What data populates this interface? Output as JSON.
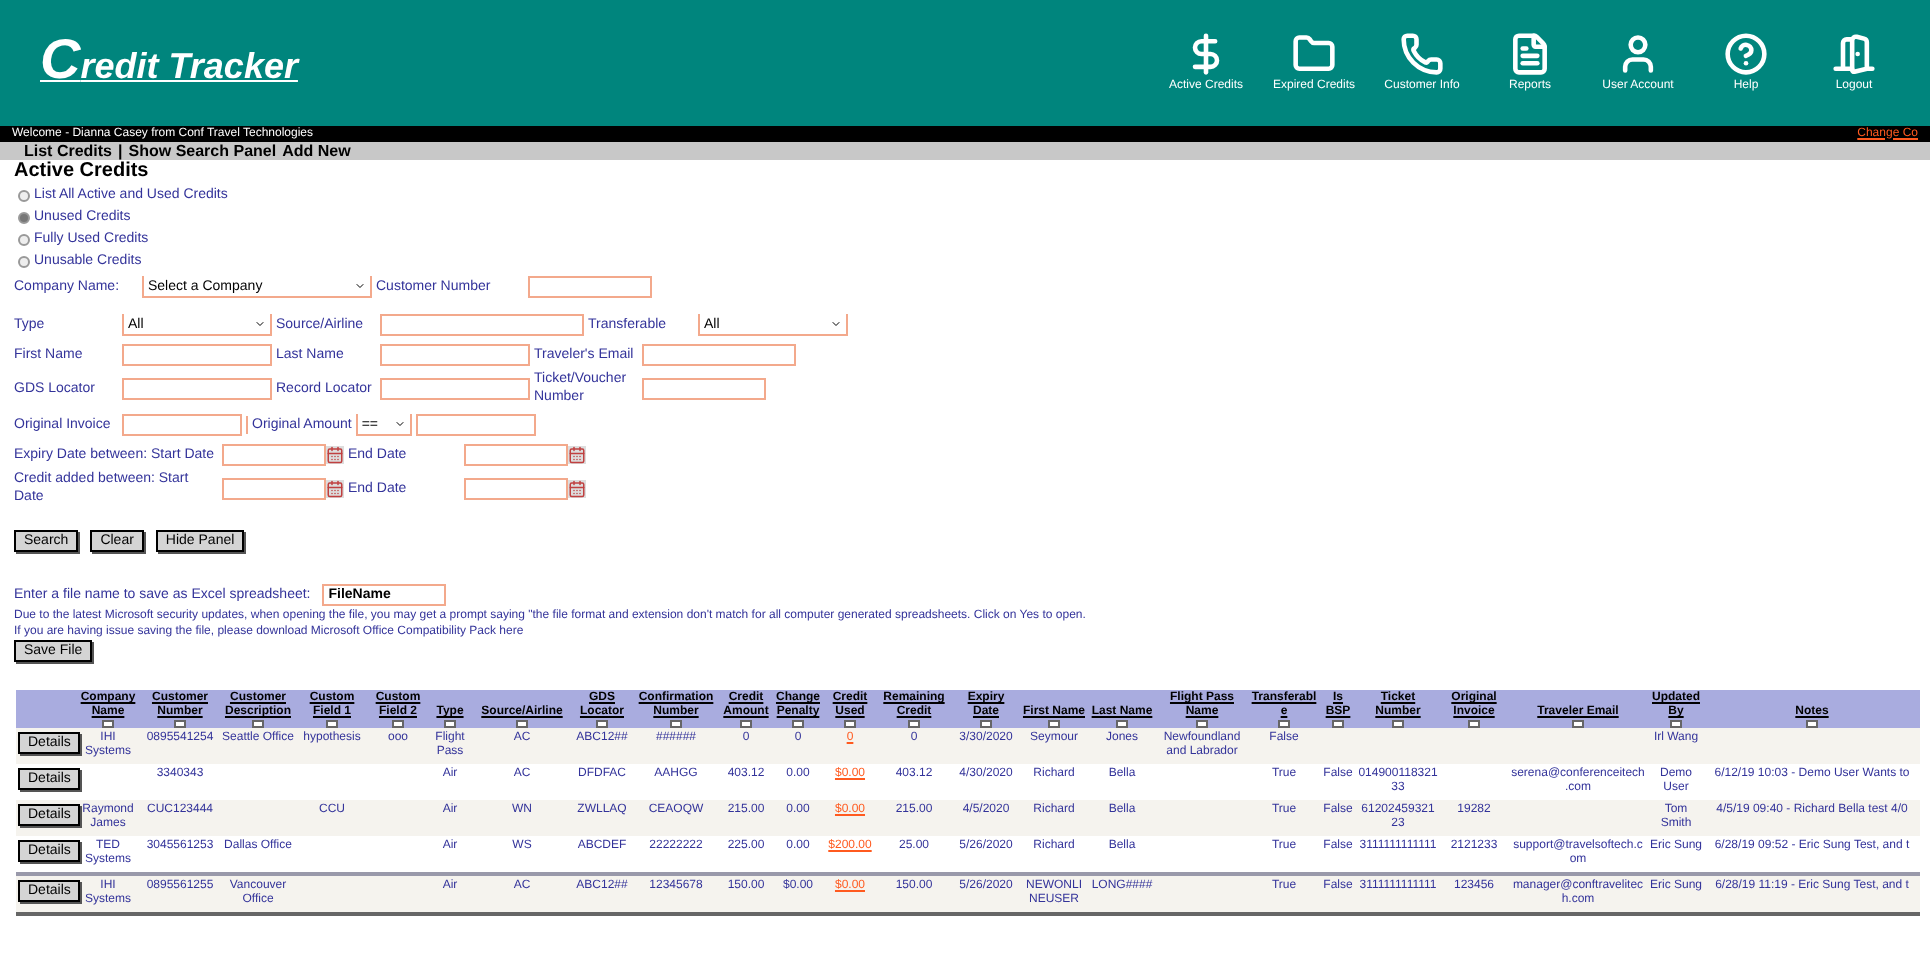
{
  "header": {
    "logo_initial": "C",
    "logo_rest": "redit Tracker",
    "nav": [
      {
        "label": "Active Credits",
        "kind": "dollar"
      },
      {
        "label": "Expired Credits",
        "kind": "folder"
      },
      {
        "label": "Customer Info",
        "kind": "phone"
      },
      {
        "label": "Reports",
        "kind": "document"
      },
      {
        "label": "User Account",
        "kind": "user"
      },
      {
        "label": "Help",
        "kind": "help"
      },
      {
        "label": "Logout",
        "kind": "door"
      }
    ]
  },
  "welcome_bar": {
    "text": "Welcome - Dianna Casey from Conf Travel Technologies",
    "link": "Change Co"
  },
  "menu": {
    "separator": "|",
    "links": [
      "List Credits",
      "Show Search Panel",
      "Add New"
    ]
  },
  "page_title": "Active Credits",
  "credit_filter": [
    {
      "label": "List All Active and Used Credits",
      "selected": false
    },
    {
      "label": "Unused Credits",
      "selected": true
    },
    {
      "label": "Fully Used Credits",
      "selected": false
    },
    {
      "label": "Unusable Credits",
      "selected": false
    }
  ],
  "search_form": {
    "company_name": {
      "label": "Company Name:",
      "value": "Select a Company"
    },
    "customer_number": {
      "label": "Customer Number"
    },
    "type": {
      "label": "Type",
      "value": "All"
    },
    "source_airline": {
      "label": "Source/Airline"
    },
    "transferable": {
      "label": "Transferable",
      "value": "All"
    },
    "first_name": {
      "label": "First Name"
    },
    "last_name": {
      "label": "Last Name"
    },
    "traveler_email": {
      "label": "Traveler's Email"
    },
    "gds_locator": {
      "label": "GDS Locator"
    },
    "record_locator": {
      "label": "Record Locator"
    },
    "ticket_voucher": {
      "label": "Ticket/Voucher Number"
    },
    "original_invoice": {
      "label": "Original Invoice"
    },
    "original_amount": {
      "label": "Original Amount",
      "operator": "=="
    },
    "expiry_dates": {
      "label": "Expiry Date between: Start Date",
      "end_label": "End Date"
    },
    "added_dates": {
      "label": "Credit added between: Start Date",
      "end_label": "End Date"
    },
    "buttons": [
      "Search",
      "Clear",
      "Hide Panel"
    ]
  },
  "export": {
    "label": "Enter a file name to save as Excel spreadsheet:",
    "value": "FileName",
    "notice": "Due to the latest Microsoft security updates, when opening the file, you may get a prompt saying \"the file format and extension don't match for all computer generated spreadsheets. Click on Yes to open.",
    "help": "If you are having issue saving the file, please download Microsoft Office Compatibility Pack here",
    "button": "Save File"
  },
  "table": {
    "columns": [
      {
        "label": "Company Name",
        "kind": "text"
      },
      {
        "label": "Customer Number",
        "kind": "text"
      },
      {
        "label": "Customer Description",
        "kind": "text"
      },
      {
        "label": "Custom Field 1",
        "kind": "text"
      },
      {
        "label": "Custom Field 2",
        "kind": "text"
      },
      {
        "label": "Type",
        "kind": "text"
      },
      {
        "label": "Source/Airline",
        "kind": "text"
      },
      {
        "label": "GDS Locator",
        "kind": "text"
      },
      {
        "label": "Confirmation Number",
        "kind": "text"
      },
      {
        "label": "Credit Amount",
        "kind": "text"
      },
      {
        "label": "Change Penalty",
        "kind": "text"
      },
      {
        "label": "Credit Used",
        "kind": "link"
      },
      {
        "label": "Remaining Credit",
        "kind": "text"
      },
      {
        "label": "Expiry Date",
        "kind": "text"
      },
      {
        "label": "First Name",
        "kind": "text"
      },
      {
        "label": "Last Name",
        "kind": "text"
      },
      {
        "label": "Flight Pass Name",
        "kind": "text"
      },
      {
        "label": "Transferable",
        "kind": "text"
      },
      {
        "label": "Is BSP",
        "kind": "text"
      },
      {
        "label": "Ticket Number",
        "kind": "text"
      },
      {
        "label": "Original Invoice",
        "kind": "text"
      },
      {
        "label": "Traveler Email",
        "kind": "text"
      },
      {
        "label": "Updated By",
        "kind": "text"
      },
      {
        "label": "Notes",
        "kind": "text"
      }
    ],
    "rows": [
      {
        "button": "Details",
        "cells": [
          "IHI Systems",
          "0895541254",
          "Seattle Office",
          "hypothesis",
          "ooo",
          "Flight Pass",
          "AC",
          "ABC12##",
          "######",
          "0",
          "0",
          "0",
          "0",
          "3/30/2020",
          "Seymour",
          "Jones",
          "Newfoundland and Labrador",
          "False",
          "",
          "",
          "",
          "",
          "Irl Wang",
          ""
        ]
      },
      {
        "button": "Details",
        "cells": [
          "",
          "3340343",
          "",
          "",
          "",
          "Air",
          "AC",
          "DFDFAC",
          "AAHGG",
          "403.12",
          "0.00",
          "$0.00",
          "403.12",
          "4/30/2020",
          "Richard",
          "Bella",
          "",
          "True",
          "False",
          "01490011832133",
          "",
          "serena@conferenceitech.com",
          "Demo User",
          "6/12/19 10:03 - Demo User Wants to"
        ]
      },
      {
        "button": "Details",
        "cells": [
          "Raymond James",
          "CUC123444",
          "",
          "CCU",
          "",
          "Air",
          "WN",
          "ZWLLAQ",
          "CEAOQW",
          "215.00",
          "0.00",
          "$0.00",
          "215.00",
          "4/5/2020",
          "Richard",
          "Bella",
          "",
          "True",
          "False",
          "6120245932123",
          "19282",
          "",
          "Tom Smith",
          "4/5/19 09:40 - Richard Bella test 4/0"
        ]
      },
      {
        "button": "Details",
        "cells": [
          "TED Systems",
          "3045561253",
          "Dallas Office",
          "",
          "",
          "Air",
          "WS",
          "ABCDEF",
          "22222222",
          "225.00",
          "0.00",
          "$200.00",
          "25.00",
          "5/26/2020",
          "Richard",
          "Bella",
          "",
          "True",
          "False",
          "3111111111111",
          "2121233",
          "support@travelsoftech.com",
          "Eric Sung",
          "6/28/19 09:52 - Eric Sung Test, and t"
        ]
      },
      {
        "button": "Details",
        "cells": [
          "IHI Systems",
          "0895561255",
          "Vancouver Office",
          "",
          "",
          "Air",
          "AC",
          "ABC12##",
          "12345678",
          "150.00",
          "$0.00",
          "$0.00",
          "150.00",
          "5/26/2020",
          "NEWONLINEUSER",
          "LONG####",
          "",
          "True",
          "False",
          "3111111111111",
          "123456",
          "manager@conftravelitech.com",
          "Eric Sung",
          "6/28/19 11:19 - Eric Sung Test, and t"
        ]
      }
    ]
  }
}
